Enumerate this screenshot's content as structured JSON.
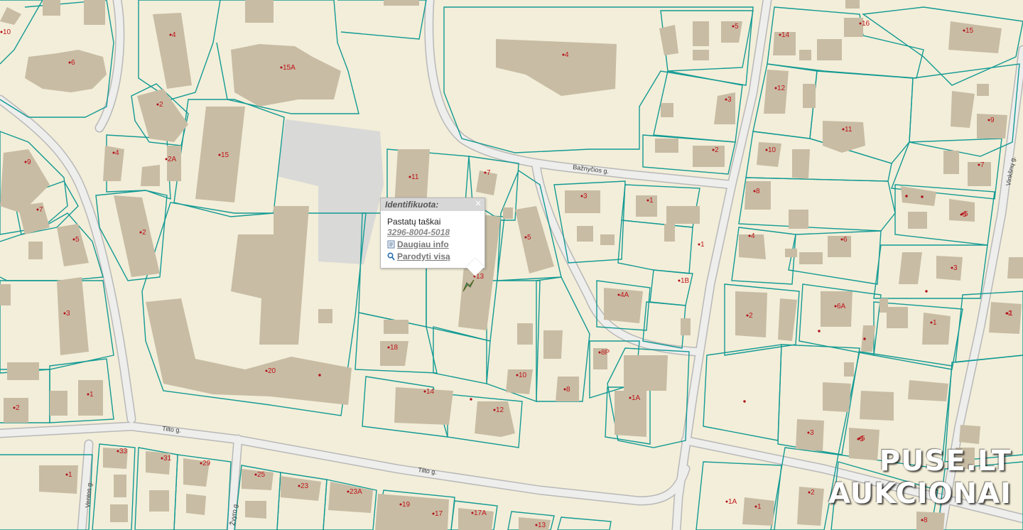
{
  "popup": {
    "title": "Identifikuota:",
    "close": "×",
    "layer": "Pastatų taškai",
    "feature_id": "3296-8004-5018",
    "more_info": "Daugiau info",
    "show_all": "Parodyti visą"
  },
  "streets": {
    "bazncios": "Bažnyčios g.",
    "tilto_west": "Tilto g.",
    "tilto_main": "Tilto g.",
    "ventos": "Ventos g.",
    "zvyro": "Žvyro g.",
    "vinksnu": "Vinkšnų g."
  },
  "house_numbers": [
    "10",
    "6",
    "4",
    "15A",
    "2",
    "4",
    "2A",
    "15",
    "9",
    "7",
    "5",
    "2",
    "3",
    "2",
    "1",
    "11",
    "7",
    "13",
    "5",
    "18",
    "20",
    "14",
    "12",
    "10",
    "8",
    "8P",
    "1A",
    "3",
    "1",
    "1",
    "1B",
    "4A",
    "4",
    "5",
    "2",
    "3",
    "5",
    "5",
    "1",
    "16",
    "15",
    "14",
    "12",
    "11",
    "10",
    "9",
    "8",
    "7",
    "6",
    "5",
    "4",
    "3",
    "2",
    "6A",
    "1",
    "2",
    "3",
    "5",
    "33",
    "31",
    "29",
    "25",
    "23",
    "23A",
    "19",
    "17",
    "17A",
    "13",
    "8",
    "2",
    "1A",
    "1"
  ],
  "watermark": {
    "line1": "PUSE.LT",
    "line2": "AUKCIONAI"
  },
  "colors": {
    "background": "#f3eed9",
    "parcel_border": "#139a94",
    "building": "#c8bca4",
    "house_number": "#c0141a",
    "road": "#eeeeec"
  }
}
